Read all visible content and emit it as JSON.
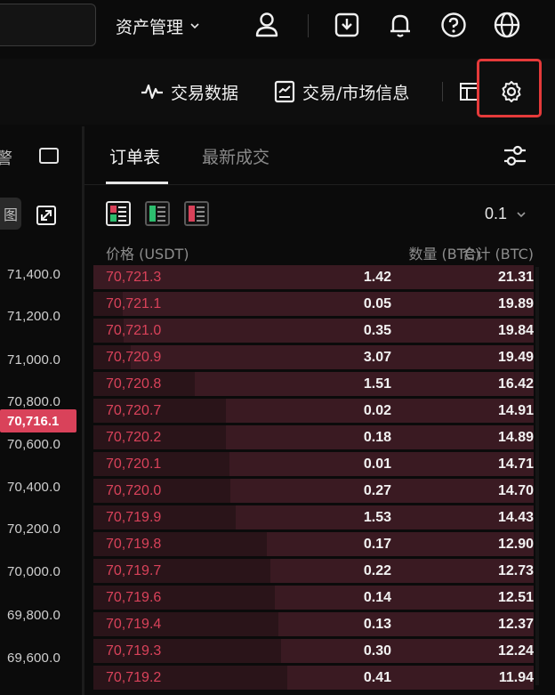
{
  "header": {
    "asset_menu_label": "资产管理",
    "icons": [
      "user-icon",
      "download-icon",
      "bell-icon",
      "help-icon",
      "globe-icon"
    ]
  },
  "toolbar": {
    "trade_data_label": "交易数据",
    "market_info_label": "交易/市场信息",
    "icons": [
      "pulse-icon",
      "document-icon",
      "layout-icon",
      "settings-icon"
    ],
    "highlight_color": "#e53a3a"
  },
  "chart_side": {
    "alert_label": "警",
    "pill_label": "图",
    "y_ticks": [
      "71,400.0",
      "71,200.0",
      "71,000.0",
      "70,800.0",
      "70,600.0",
      "70,400.0",
      "70,200.0",
      "70,000.0",
      "69,800.0",
      "69,600.0"
    ],
    "current_price": "70,716.1",
    "current_price_color": "#d9425a"
  },
  "order_book": {
    "tabs": [
      {
        "label": "订单表",
        "active": true
      },
      {
        "label": "最新成交",
        "active": false
      }
    ],
    "precision": "0.1",
    "columns": {
      "price": "价格 (USDT)",
      "qty": "数量 (BTC)",
      "total": "合计 (BTC)"
    },
    "asks": [
      {
        "price": "70,721.3",
        "qty": "1.42",
        "total": "21.31"
      },
      {
        "price": "70,721.1",
        "qty": "0.05",
        "total": "19.89"
      },
      {
        "price": "70,721.0",
        "qty": "0.35",
        "total": "19.84"
      },
      {
        "price": "70,720.9",
        "qty": "3.07",
        "total": "19.49"
      },
      {
        "price": "70,720.8",
        "qty": "1.51",
        "total": "16.42"
      },
      {
        "price": "70,720.7",
        "qty": "0.02",
        "total": "14.91"
      },
      {
        "price": "70,720.2",
        "qty": "0.18",
        "total": "14.89"
      },
      {
        "price": "70,720.1",
        "qty": "0.01",
        "total": "14.71"
      },
      {
        "price": "70,720.0",
        "qty": "0.27",
        "total": "14.70"
      },
      {
        "price": "70,719.9",
        "qty": "1.53",
        "total": "14.43"
      },
      {
        "price": "70,719.8",
        "qty": "0.17",
        "total": "12.90"
      },
      {
        "price": "70,719.7",
        "qty": "0.22",
        "total": "12.73"
      },
      {
        "price": "70,719.6",
        "qty": "0.14",
        "total": "12.51"
      },
      {
        "price": "70,719.4",
        "qty": "0.13",
        "total": "12.37"
      },
      {
        "price": "70,719.3",
        "qty": "0.30",
        "total": "12.24"
      },
      {
        "price": "70,719.2",
        "qty": "0.41",
        "total": "11.94"
      }
    ],
    "ask_color": "#d9425a"
  }
}
